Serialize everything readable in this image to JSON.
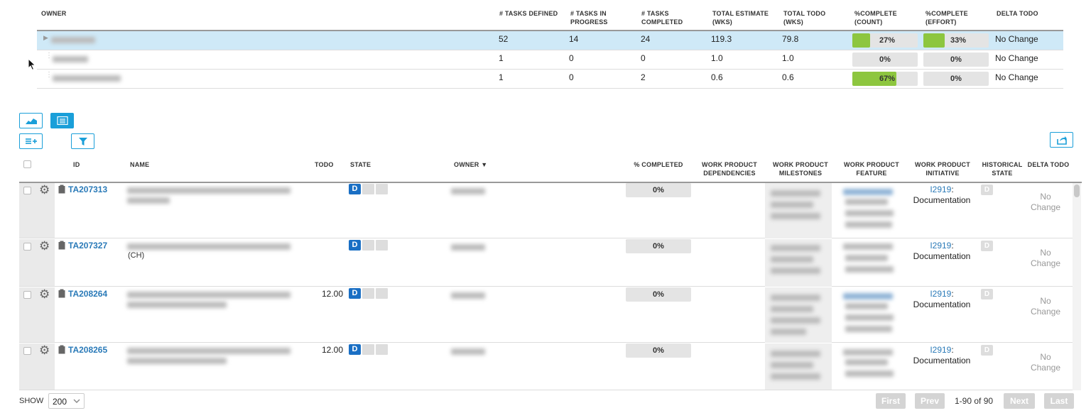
{
  "summary": {
    "headers": {
      "owner": "OWNER",
      "tasks_defined": "# TASKS DEFINED",
      "tasks_in_progress": "# TASKS IN PROGRESS",
      "tasks_completed": "# TASKS COMPLETED",
      "total_estimate": "TOTAL ESTIMATE (WKS)",
      "total_todo": "TOTAL TODO (WKS)",
      "pct_count": "%COMPLETE (COUNT)",
      "pct_effort": "%COMPLETE (EFFORT)",
      "delta_todo": "DELTA TODO"
    },
    "rows": [
      {
        "tasks_defined": "52",
        "tasks_in_progress": "14",
        "tasks_completed": "24",
        "total_estimate": "119.3",
        "total_todo": "79.8",
        "pct_count": "27%",
        "pct_count_value": 0.27,
        "pct_effort": "33%",
        "pct_effort_value": 0.33,
        "delta_todo": "No Change"
      },
      {
        "tasks_defined": "1",
        "tasks_in_progress": "0",
        "tasks_completed": "0",
        "total_estimate": "1.0",
        "total_todo": "1.0",
        "pct_count": "0%",
        "pct_count_value": 0,
        "pct_effort": "0%",
        "pct_effort_value": 0,
        "delta_todo": "No Change"
      },
      {
        "tasks_defined": "1",
        "tasks_in_progress": "0",
        "tasks_completed": "2",
        "total_estimate": "0.6",
        "total_todo": "0.6",
        "pct_count": "67%",
        "pct_count_value": 0.67,
        "pct_effort": "0%",
        "pct_effort_value": 0,
        "delta_todo": "No Change"
      }
    ]
  },
  "toolbar": {
    "icons": [
      "area-chart-icon",
      "list-icon",
      "add-rows-icon",
      "filter-icon",
      "export-icon"
    ]
  },
  "grid": {
    "headers": {
      "id": "ID",
      "name": "NAME",
      "todo": "TODO",
      "state": "STATE",
      "owner": "OWNER",
      "pct_completed": "% COMPLETED",
      "wp_dependencies": "WORK PRODUCT DEPENDENCIES",
      "wp_milestones": "WORK PRODUCT MILESTONES",
      "wp_feature": "WORK PRODUCT FEATURE",
      "wp_initiative": "WORK PRODUCT INITIATIVE",
      "historical_state": "HISTORICAL STATE",
      "delta_todo": "DELTA TODO"
    },
    "owner_sort": "descending",
    "rows": [
      {
        "id": "TA207313",
        "name_visible": "",
        "todo": "",
        "state": "D",
        "pct_completed": "0%",
        "initiative_link": "I2919",
        "initiative_sep": ":",
        "initiative_name": "Documentation",
        "historical_state": "D",
        "delta_todo": "No Change"
      },
      {
        "id": "TA207327",
        "name_visible": "(CH)",
        "todo": "",
        "state": "D",
        "pct_completed": "0%",
        "initiative_link": "I2919",
        "initiative_sep": ":",
        "initiative_name": "Documentation",
        "historical_state": "D",
        "delta_todo": "No Change"
      },
      {
        "id": "TA208264",
        "name_visible": "",
        "todo": "12.00",
        "state": "D",
        "pct_completed": "0%",
        "initiative_link": "I2919",
        "initiative_sep": ":",
        "initiative_name": "Documentation",
        "historical_state": "D",
        "delta_todo": "No Change"
      },
      {
        "id": "TA208265",
        "name_visible": "",
        "todo": "12.00",
        "state": "D",
        "pct_completed": "0%",
        "initiative_link": "I2919",
        "initiative_sep": ":",
        "initiative_name": "Documentation",
        "historical_state": "D",
        "delta_todo": "No Change"
      }
    ]
  },
  "pager": {
    "show_label": "SHOW",
    "page_size": "200",
    "first": "First",
    "prev": "Prev",
    "range": "1-90 of 90",
    "next": "Next",
    "last": "Last"
  },
  "colors": {
    "accent": "#1a9fd9",
    "progress": "#8dc63f",
    "selected_row": "#cfe9f7",
    "state_defined": "#1a6fc4",
    "link": "#2a7ab8"
  }
}
